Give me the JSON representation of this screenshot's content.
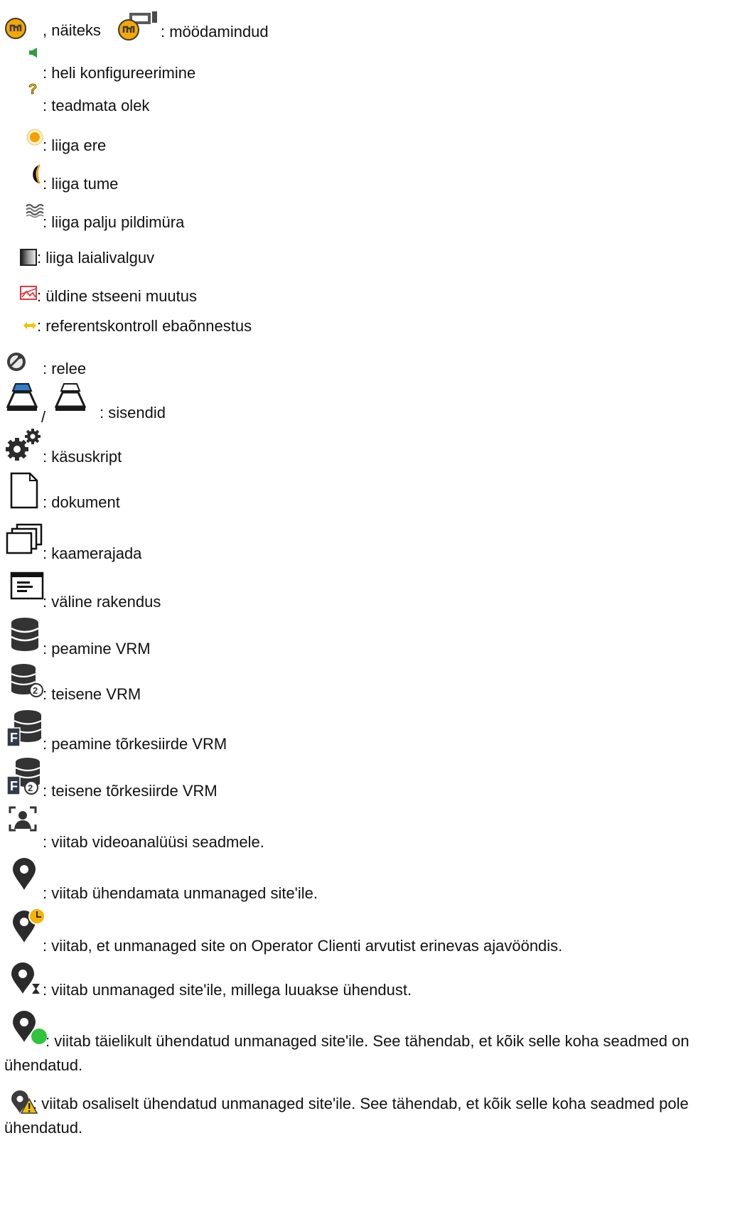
{
  "items": [
    {
      "id": "bypassed",
      "prefix": ", näiteks",
      "text": ": möödamindud",
      "icons": [
        "bypass-device-icon",
        "bypassed-encoder-example-icon"
      ]
    },
    {
      "id": "audio",
      "text": ": heli konfigureerimine",
      "icons": [
        "speaker-audio-icon"
      ]
    },
    {
      "id": "unknown",
      "text": ": teadmata olek",
      "icons": [
        "question-mark-icon"
      ]
    },
    {
      "id": "too-bright",
      "text": ": liiga ere",
      "icons": [
        "sun-icon"
      ]
    },
    {
      "id": "too-dark",
      "text": ": liiga tume",
      "icons": [
        "moon-icon"
      ]
    },
    {
      "id": "too-noisy",
      "text": ": liiga palju pildimüra",
      "icons": [
        "noise-waves-icon"
      ]
    },
    {
      "id": "too-blurry",
      "text": ": liiga laialivalguv",
      "icons": [
        "blur-gradient-icon"
      ]
    },
    {
      "id": "scene-change",
      "text": ": üldine stseeni muutus",
      "icons": [
        "scene-change-icon"
      ]
    },
    {
      "id": "ref-check",
      "text": ": referentskontroll ebaõnnestus",
      "icons": [
        "double-arrow-icon"
      ]
    },
    {
      "id": "relay",
      "text": ": relee",
      "icons": [
        "relay-icon"
      ]
    },
    {
      "id": "inputs",
      "separator": "/",
      "text": ": sisendid",
      "icons": [
        "input-active-icon",
        "input-inactive-icon"
      ]
    },
    {
      "id": "script",
      "text": ": käsuskript",
      "icons": [
        "gears-icon"
      ]
    },
    {
      "id": "document",
      "text": ": dokument",
      "icons": [
        "document-icon"
      ]
    },
    {
      "id": "sequence",
      "text": ": kaamerajada",
      "icons": [
        "camera-sequence-icon"
      ]
    },
    {
      "id": "external-app",
      "text": ": väline rakendus",
      "icons": [
        "external-app-icon"
      ]
    },
    {
      "id": "primary-vrm",
      "text": ": peamine VRM",
      "icons": [
        "database-icon"
      ]
    },
    {
      "id": "secondary-vrm",
      "text": ": teisene VRM",
      "icons": [
        "database-secondary-icon"
      ]
    },
    {
      "id": "failover-vrm",
      "text": ": peamine tõrkesiirde VRM",
      "icons": [
        "database-failover-icon"
      ]
    },
    {
      "id": "secondary-failover-vrm",
      "text": ": teisene tõrkesiirde VRM",
      "icons": [
        "database-secondary-failover-icon"
      ]
    },
    {
      "id": "video-analytics",
      "text": ": viitab videoanalüüsi seadmele.",
      "icons": [
        "video-analytics-icon"
      ]
    },
    {
      "id": "site-disconnected",
      "text": ": viitab ühendamata unmanaged site'ile.",
      "icons": [
        "map-pin-icon"
      ]
    },
    {
      "id": "site-timezone",
      "text": ": viitab, et unmanaged site on Operator Clienti arvutist erinevas ajavööndis.",
      "icons": [
        "map-pin-clock-icon"
      ]
    },
    {
      "id": "site-connecting",
      "text": ": viitab unmanaged site'ile, millega luuakse ühendust.",
      "icons": [
        "map-pin-hourglass-icon"
      ]
    },
    {
      "id": "site-connected",
      "text": ": viitab täielikult ühendatud unmanaged site'ile. See tähendab, et kõik selle koha seadmed on ühendatud.",
      "icons": [
        "map-pin-connected-icon"
      ]
    },
    {
      "id": "site-partial",
      "text": ": viitab osaliselt ühendatud unmanaged site'ile. See tähendab, et kõik selle koha seadmed pole ühendatud.",
      "icons": [
        "map-pin-warning-icon"
      ]
    }
  ],
  "colors": {
    "text": "#111111",
    "bypass_yellow": "#f5a800",
    "audio_green": "#2e9e3f",
    "warning_yellow": "#f2c200",
    "scene_red": "#e0393e",
    "input_blue": "#2d7ecb",
    "status_green": "#2fc43c",
    "dark_gray": "#3c3c3c"
  }
}
